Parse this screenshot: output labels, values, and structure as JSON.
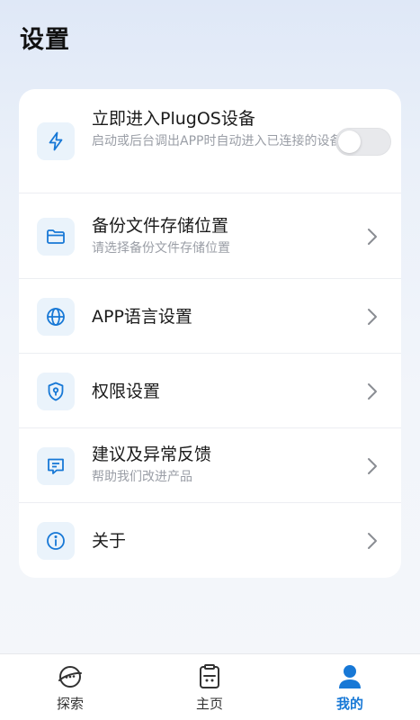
{
  "header": {
    "title": "设置"
  },
  "settings": {
    "items": [
      {
        "title": "立即进入PlugOS设备",
        "subtitle": "启动或后台调出APP时自动进入已连接的设备",
        "icon": "lightning-icon",
        "control": "toggle",
        "toggle_on": false
      },
      {
        "title": "备份文件存储位置",
        "subtitle": "请选择备份文件存储位置",
        "icon": "folder-icon",
        "control": "chevron"
      },
      {
        "title": "APP语言设置",
        "icon": "globe-icon",
        "control": "chevron"
      },
      {
        "title": "权限设置",
        "icon": "shield-key-icon",
        "control": "chevron"
      },
      {
        "title": "建议及异常反馈",
        "subtitle": "帮助我们改进产品",
        "icon": "feedback-icon",
        "control": "chevron"
      },
      {
        "title": "关于",
        "icon": "info-icon",
        "control": "chevron"
      }
    ]
  },
  "tabbar": {
    "tabs": [
      {
        "label": "探索",
        "icon": "planet-chat-icon",
        "active": false
      },
      {
        "label": "主页",
        "icon": "device-icon",
        "active": false
      },
      {
        "label": "我的",
        "icon": "user-icon",
        "active": true
      }
    ]
  },
  "colors": {
    "accent": "#1778d6",
    "icon_bg": "#eaf3fb",
    "text_primary": "#1b1b1b",
    "text_secondary": "#9a9ea6"
  }
}
